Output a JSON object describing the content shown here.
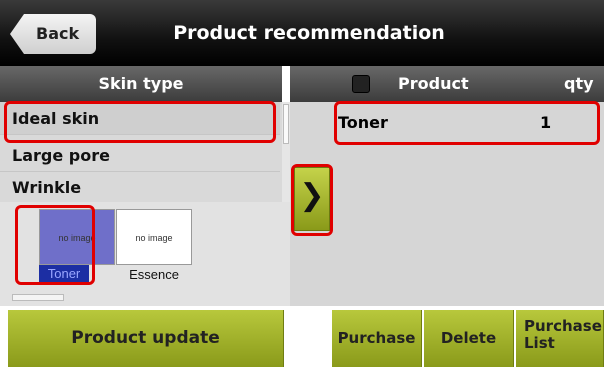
{
  "header": {
    "back_label": "Back",
    "title": "Product recommendation"
  },
  "skin_panel": {
    "header": "Skin type",
    "items": [
      {
        "label": "Ideal skin"
      },
      {
        "label": "Large pore"
      },
      {
        "label": "Wrinkle"
      }
    ]
  },
  "product_images": [
    {
      "image_text": "no image",
      "label": "Toner"
    },
    {
      "image_text": "no image",
      "label": "Essence"
    }
  ],
  "product_panel": {
    "header_product": "Product",
    "header_qty": "qty",
    "rows": [
      {
        "product": "Toner",
        "qty": "1"
      }
    ]
  },
  "arrow_glyph": "❯",
  "buttons": {
    "product_update": "Product update",
    "purchase": "Purchase",
    "delete": "Delete",
    "purchase_list": "Purchase List"
  },
  "colors": {
    "accent": "#a6b62a",
    "highlight": "#e00000",
    "selected_thumb": "#6f6fc9"
  }
}
